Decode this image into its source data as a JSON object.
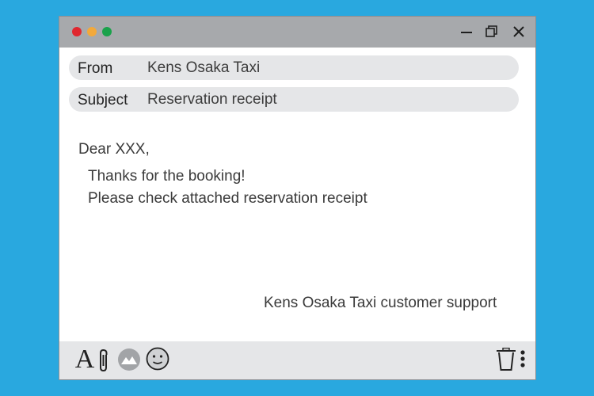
{
  "window": {
    "traffic_lights": {
      "close_color": "#e0272f",
      "minimize_color": "#f2a93b",
      "zoom_color": "#1aa24b"
    },
    "controls": [
      "minimize-icon",
      "restore-icon",
      "close-icon"
    ]
  },
  "email": {
    "from_label": "From",
    "from_value": "Kens Osaka Taxi",
    "subject_label": "Subject",
    "subject_value": "Reservation receipt",
    "greeting": "Dear XXX,",
    "line1": "Thanks for the booking!",
    "line2": "Please check attached reservation receipt",
    "signature": "Kens Osaka Taxi customer support"
  },
  "toolbar": {
    "font_glyph": "A",
    "icons": [
      "font-icon",
      "paperclip-icon",
      "image-icon",
      "emoji-icon",
      "trash-icon",
      "more-vertical-icon"
    ]
  },
  "colors": {
    "background": "#29a8df",
    "titlebar": "#a7a9ac",
    "field": "#e5e6e8"
  }
}
